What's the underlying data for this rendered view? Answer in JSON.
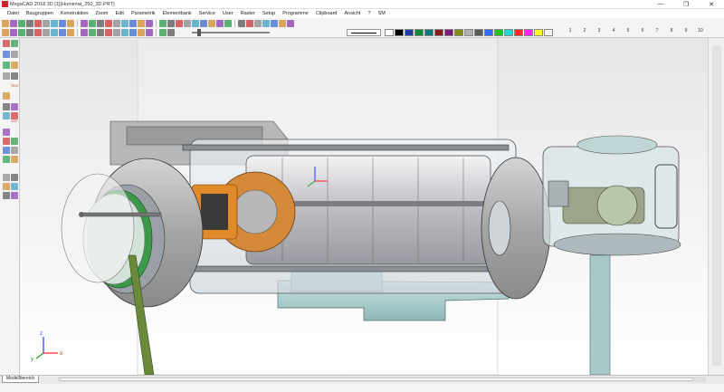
{
  "window": {
    "title": "MegaCAD 2018 3D [1](Humimat_250_3D.PRT)",
    "minimize": "—",
    "restore": "❐",
    "close": "✕"
  },
  "menu": [
    "Datei",
    "Baugruppen",
    "Konstruktion",
    "Zoom",
    "Edit",
    "Parametrik",
    "Elementbank",
    "Service",
    "User",
    "Raster",
    "Setup",
    "Programme",
    "Clipboard",
    "Ansicht",
    "?",
    "SM"
  ],
  "toolbar": {
    "palette": [
      "#ffffff",
      "#000000",
      "#1f3fa8",
      "#0b8a3a",
      "#0a7a7a",
      "#8a1c1c",
      "#7a1a7a",
      "#8a8a1a",
      "#b0b0b0",
      "#5a5a5a",
      "#2f6bff",
      "#22c222",
      "#22d6d6",
      "#ff2a2a",
      "#ff2aff",
      "#ffff22",
      "#f2f2f2"
    ],
    "layers": [
      "1",
      "2",
      "3",
      "4",
      "5",
      "6",
      "7",
      "8",
      "9",
      "10"
    ]
  },
  "sidebar": {
    "label_text": "TEXT",
    "label_dist": "DIST"
  },
  "bottom": {
    "model_tab": "Modellbereich"
  },
  "axes": {
    "x": "x",
    "y": "y",
    "z": "z"
  }
}
